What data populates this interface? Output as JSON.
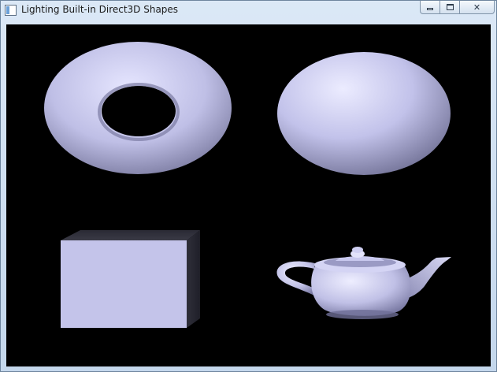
{
  "window": {
    "title": "Lighting Built-in Direct3D Shapes",
    "icon": "application-window-icon",
    "controls": {
      "minimize": "minimize-icon",
      "maximize": "restore-icon",
      "close": "close-icon",
      "close_glyph": "✕"
    }
  },
  "scene": {
    "background_color": "#000000",
    "material_color": "#c0c0e8",
    "shapes": [
      "torus",
      "sphere",
      "box",
      "teapot"
    ]
  }
}
